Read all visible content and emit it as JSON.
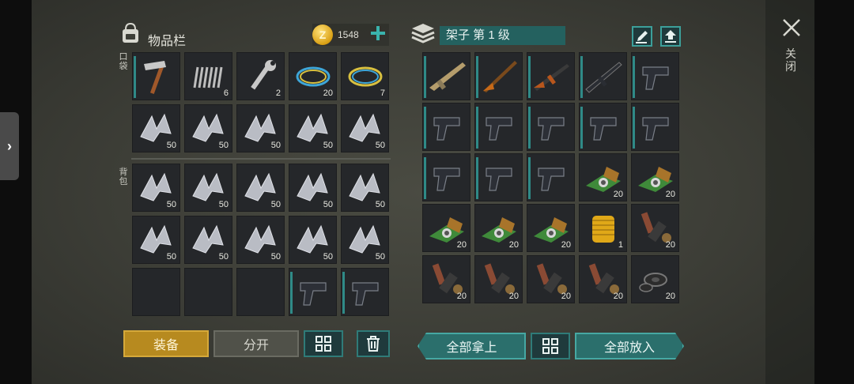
{
  "header": {
    "inventory_title": "物品栏",
    "coins": "1548",
    "shelf_title": "架子 第 1 级",
    "close_label": "关闭"
  },
  "sections": {
    "pocket": "口袋",
    "backpack": "背包"
  },
  "left_grid": [
    {
      "item": "hammer",
      "qty": ""
    },
    {
      "item": "spring",
      "qty": "6"
    },
    {
      "item": "wrench",
      "qty": "2"
    },
    {
      "item": "wire-blue",
      "qty": "20"
    },
    {
      "item": "wire-yellow",
      "qty": "7"
    },
    {
      "item": "scrap",
      "qty": "50"
    },
    {
      "item": "scrap",
      "qty": "50"
    },
    {
      "item": "scrap",
      "qty": "50"
    },
    {
      "item": "scrap",
      "qty": "50"
    },
    {
      "item": "scrap",
      "qty": "50"
    },
    {
      "item": "scrap",
      "qty": "50"
    },
    {
      "item": "scrap",
      "qty": "50"
    },
    {
      "item": "scrap",
      "qty": "50"
    },
    {
      "item": "scrap",
      "qty": "50"
    },
    {
      "item": "scrap",
      "qty": "50"
    },
    {
      "item": "scrap",
      "qty": "50"
    },
    {
      "item": "scrap",
      "qty": "50"
    },
    {
      "item": "scrap",
      "qty": "50"
    },
    {
      "item": "scrap",
      "qty": "50"
    },
    {
      "item": "scrap",
      "qty": "50"
    },
    {
      "item": "empty",
      "qty": ""
    },
    {
      "item": "empty",
      "qty": ""
    },
    {
      "item": "empty",
      "qty": ""
    },
    {
      "item": "pistol",
      "qty": ""
    },
    {
      "item": "pistol",
      "qty": ""
    }
  ],
  "right_grid": [
    {
      "item": "rifle-tan",
      "qty": ""
    },
    {
      "item": "shotgun",
      "qty": ""
    },
    {
      "item": "ak",
      "qty": ""
    },
    {
      "item": "m4",
      "qty": ""
    },
    {
      "item": "pistol",
      "qty": ""
    },
    {
      "item": "pistol",
      "qty": ""
    },
    {
      "item": "pistol",
      "qty": ""
    },
    {
      "item": "pistol",
      "qty": ""
    },
    {
      "item": "pistol",
      "qty": ""
    },
    {
      "item": "pistol",
      "qty": ""
    },
    {
      "item": "pistol",
      "qty": ""
    },
    {
      "item": "pistol",
      "qty": ""
    },
    {
      "item": "pistol",
      "qty": ""
    },
    {
      "item": "circuit",
      "qty": "20"
    },
    {
      "item": "circuit",
      "qty": "20"
    },
    {
      "item": "circuit",
      "qty": "20"
    },
    {
      "item": "circuit",
      "qty": "20"
    },
    {
      "item": "circuit",
      "qty": "20"
    },
    {
      "item": "filter",
      "qty": "1"
    },
    {
      "item": "parts",
      "qty": "20"
    },
    {
      "item": "parts",
      "qty": "20"
    },
    {
      "item": "parts",
      "qty": "20"
    },
    {
      "item": "parts",
      "qty": "20"
    },
    {
      "item": "parts",
      "qty": "20"
    },
    {
      "item": "washers",
      "qty": "20"
    }
  ],
  "buttons": {
    "equip": "装备",
    "split": "分开",
    "take_all": "全部拿上",
    "put_all": "全部放入"
  },
  "colors": {
    "accent": "#2f8a87",
    "equip": "#b78a1f"
  }
}
